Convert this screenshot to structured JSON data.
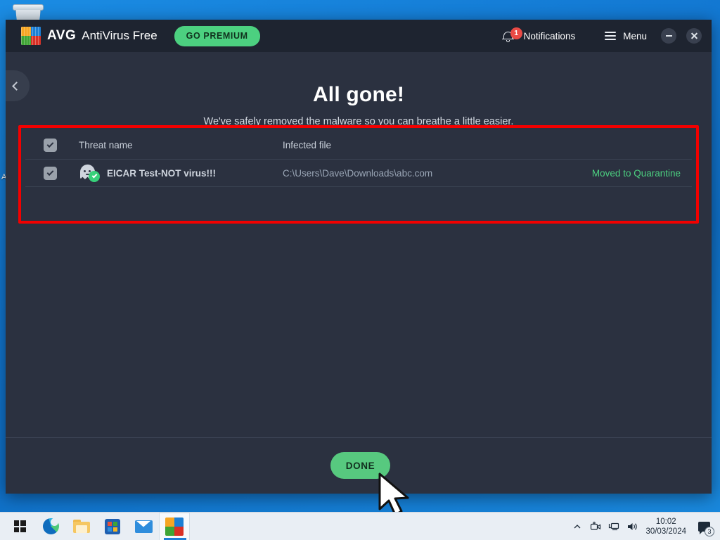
{
  "window": {
    "brand_avg": "AVG",
    "brand_product": "AntiVirus Free",
    "go_premium_label": "GO PREMIUM",
    "notifications_label": "Notifications",
    "notifications_count": "1",
    "menu_label": "Menu",
    "minimize_icon": "minimize-icon",
    "close_icon": "close-icon",
    "back_icon": "chevron-left-icon",
    "logo_icon": "avg-logo-icon",
    "bell_icon": "bell-icon",
    "hamburger_icon": "hamburger-icon"
  },
  "hero": {
    "title": "All gone!",
    "subtitle": "We've safely removed the malware so you can breathe a little easier."
  },
  "table": {
    "headers": {
      "threat_name": "Threat name",
      "infected_file": "Infected file",
      "status": ""
    },
    "rows": [
      {
        "checked": true,
        "icon": "ghost-threat-icon",
        "threat_name": "EICAR Test-NOT virus!!!",
        "infected_file": "C:\\Users\\Dave\\Downloads\\abc.com",
        "status": "Moved to Quarantine"
      }
    ]
  },
  "footer": {
    "done_label": "DONE"
  },
  "colors": {
    "accent_green": "#4cd080",
    "button_green": "#57c97f",
    "status_green": "#4cd080",
    "badge_red": "#ea4a45",
    "annotation_red": "#f20000",
    "window_bg": "#2b3140",
    "titlebar_bg": "#1e2430",
    "desktop_blue": "#1277d1"
  },
  "desktop": {
    "recycle_bin_icon": "recycle-bin-icon",
    "left_icon_label": "A"
  },
  "taskbar": {
    "items": [
      {
        "name": "start-button",
        "icon": "windows-logo-icon"
      },
      {
        "name": "taskbar-item-edge",
        "icon": "edge-icon"
      },
      {
        "name": "taskbar-item-file-explorer",
        "icon": "folder-icon"
      },
      {
        "name": "taskbar-item-microsoft-store",
        "icon": "store-icon"
      },
      {
        "name": "taskbar-item-mail",
        "icon": "mail-icon"
      },
      {
        "name": "taskbar-item-avg",
        "icon": "avg-logo-icon"
      }
    ],
    "tray": {
      "overflow_icon": "chevron-up-icon",
      "camera_icon": "camera-icon",
      "network_icon": "network-icon",
      "volume_icon": "volume-icon",
      "time": "10:02",
      "date": "30/03/2024",
      "chat_icon": "chat-icon",
      "chat_count": "3"
    }
  }
}
